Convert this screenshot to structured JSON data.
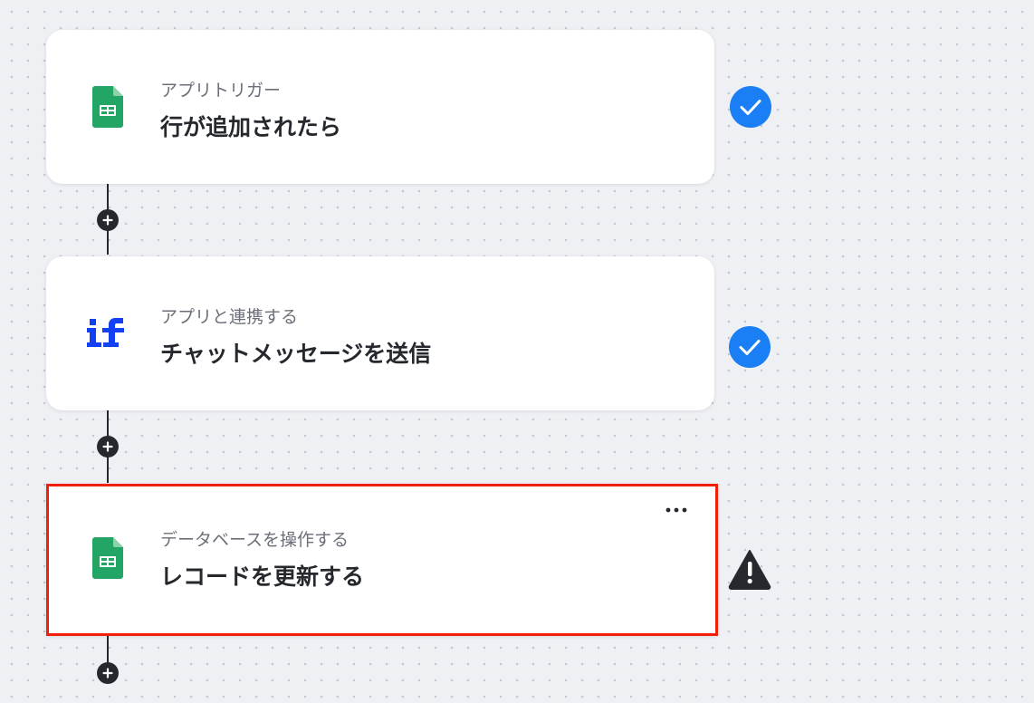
{
  "workflow": {
    "steps": [
      {
        "app_icon": "google-sheets-icon",
        "label": "アプリトリガー",
        "title": "行が追加されたら",
        "status": "completed",
        "status_icon": "check-circle-icon"
      },
      {
        "app_icon": "if-logo-icon",
        "label": "アプリと連携する",
        "title": "チャットメッセージを送信",
        "status": "completed",
        "status_icon": "check-circle-icon"
      },
      {
        "app_icon": "google-sheets-icon",
        "label": "データベースを操作する",
        "title": "レコードを更新する",
        "status": "warning",
        "status_icon": "warning-triangle-icon",
        "selected": true,
        "menu_icon": "more-horizontal-icon"
      }
    ],
    "add_step_icon": "plus-icon"
  },
  "colors": {
    "sheets_green": "#23a566",
    "if_blue": "#1340f2",
    "check_blue": "#1a7ef5",
    "selection_red": "#f0200a",
    "dark": "#25282d"
  }
}
